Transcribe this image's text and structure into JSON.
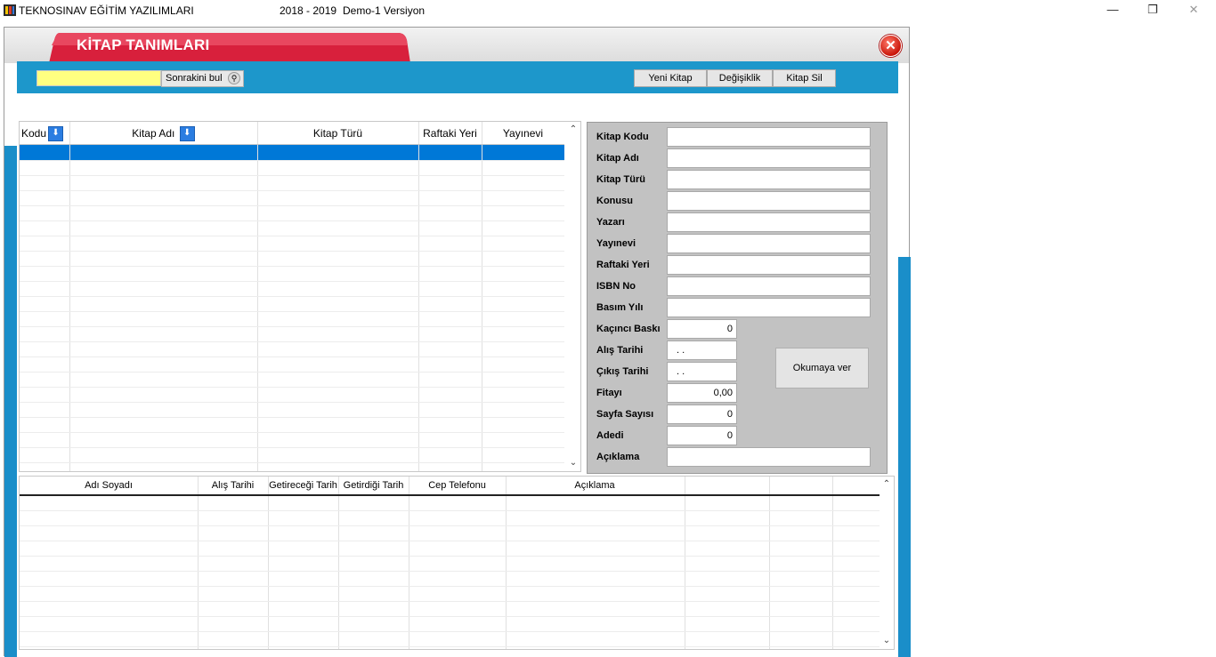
{
  "window": {
    "app_name": "TEKNOSINAV EĞİTİM YAZILIMLARI",
    "year": "2018 - 2019",
    "version": "Demo-1 Versiyon",
    "minimize": "—",
    "restore": "❐",
    "close": "✕"
  },
  "form_title": "KİTAP TANIMLARI",
  "close_glyph": "✕",
  "toolbar": {
    "search_value": "",
    "find_next_label": "Sonrakini bul",
    "new_book": "Yeni Kitap",
    "edit": "Değişiklik",
    "delete_book": "Kitap Sil"
  },
  "books_table": {
    "columns": [
      "Kodu",
      "Kitap Adı",
      "Kitap Türü",
      "Raftaki Yeri",
      "Yayınevi"
    ],
    "rows": []
  },
  "book_form": {
    "labels": {
      "code": "Kitap Kodu",
      "name": "Kitap Adı",
      "type": "Kitap Türü",
      "subject": "Konusu",
      "author": "Yazarı",
      "publisher": "Yayınevi",
      "shelf": "Raftaki Yeri",
      "isbn": "ISBN No",
      "print_year": "Basım Yılı",
      "edition": "Kaçıncı Baskı",
      "purchase_date": "Alış Tarihi",
      "release_date": "Çıkış Tarihi",
      "price": "Fitayı",
      "pages": "Sayfa Sayısı",
      "count": "Adedi",
      "note": "Açıklama"
    },
    "values": {
      "code": "",
      "name": "",
      "type": "",
      "subject": "",
      "author": "",
      "publisher": "",
      "shelf": "",
      "isbn": "",
      "print_year": "",
      "edition": "0",
      "purchase_date": ".  .",
      "release_date": ".  .",
      "price": "0,00",
      "pages": "0",
      "count": "0",
      "note": ""
    },
    "lend_button": "Okumaya ver"
  },
  "loans_table": {
    "columns": [
      "Adı Soyadı",
      "Alış Tarihi",
      "Getireceği Tarih",
      "Getirdiği Tarih",
      "Cep Telefonu",
      "Açıklama"
    ],
    "rows": []
  },
  "colors": {
    "accent_blue": "#1d97cb",
    "title_red": "#d8203c",
    "selection": "#0078d7",
    "search_yellow": "#ffff80"
  }
}
